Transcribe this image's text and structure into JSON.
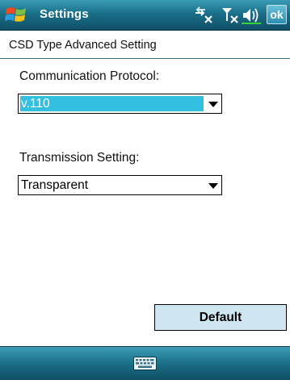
{
  "titlebar": {
    "title": "Settings",
    "start_icon": "windows-flag-icon",
    "status_icons": [
      "connectivity-off-icon",
      "signal-off-icon",
      "speaker-icon"
    ],
    "ok_label": "ok"
  },
  "header": {
    "title": "CSD Type Advanced Setting"
  },
  "protocol": {
    "label": "Communication Protocol:",
    "value": "v.110"
  },
  "transmission": {
    "label": "Transmission Setting:",
    "value": "Transparent"
  },
  "default_label": "Default",
  "bottombar": {
    "keyboard_icon": "keyboard-icon"
  },
  "colors": {
    "titlebar": "#1a6f8a",
    "selection": "#33bfe0",
    "button_bg": "#cde6ef"
  }
}
